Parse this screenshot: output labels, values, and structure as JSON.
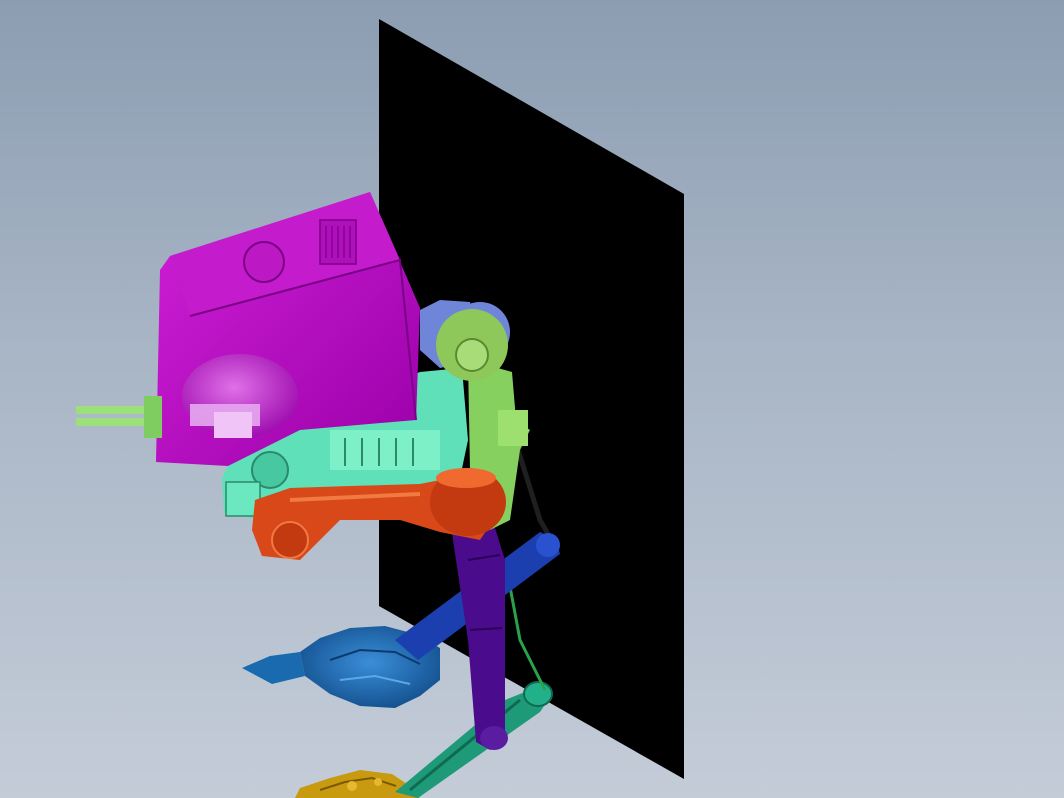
{
  "scene": {
    "background_top": "#8c9db2",
    "background_bottom": "#c4ccd8",
    "parts": [
      {
        "name": "reference-plane",
        "color": "#000000"
      },
      {
        "name": "cockpit-head",
        "color": "#b000b8"
      },
      {
        "name": "head-turret-disc",
        "color": "#c832d0"
      },
      {
        "name": "chin-guns",
        "color": "#9be07a"
      },
      {
        "name": "side-blaster",
        "color": "#e6a8ef"
      },
      {
        "name": "engine-body",
        "color": "#5fe0b8"
      },
      {
        "name": "hip-wheel",
        "color": "#8fc85a"
      },
      {
        "name": "hip-drum",
        "color": "#6f86d8"
      },
      {
        "name": "hip-strut",
        "color": "#86d060"
      },
      {
        "name": "upper-leg",
        "color": "#d84818"
      },
      {
        "name": "knee-joint",
        "color": "#c43a10"
      },
      {
        "name": "shin",
        "color": "#4a0c8c"
      },
      {
        "name": "piston-rear",
        "color": "#1c3fb0"
      },
      {
        "name": "drive-cable",
        "color": "#1f1f1f"
      },
      {
        "name": "green-cable",
        "color": "#2aa24a"
      },
      {
        "name": "foot",
        "color": "#1a6ab0"
      },
      {
        "name": "lower-leg",
        "color": "#1e9a78"
      },
      {
        "name": "gold-foot",
        "color": "#c89a10"
      }
    ]
  }
}
